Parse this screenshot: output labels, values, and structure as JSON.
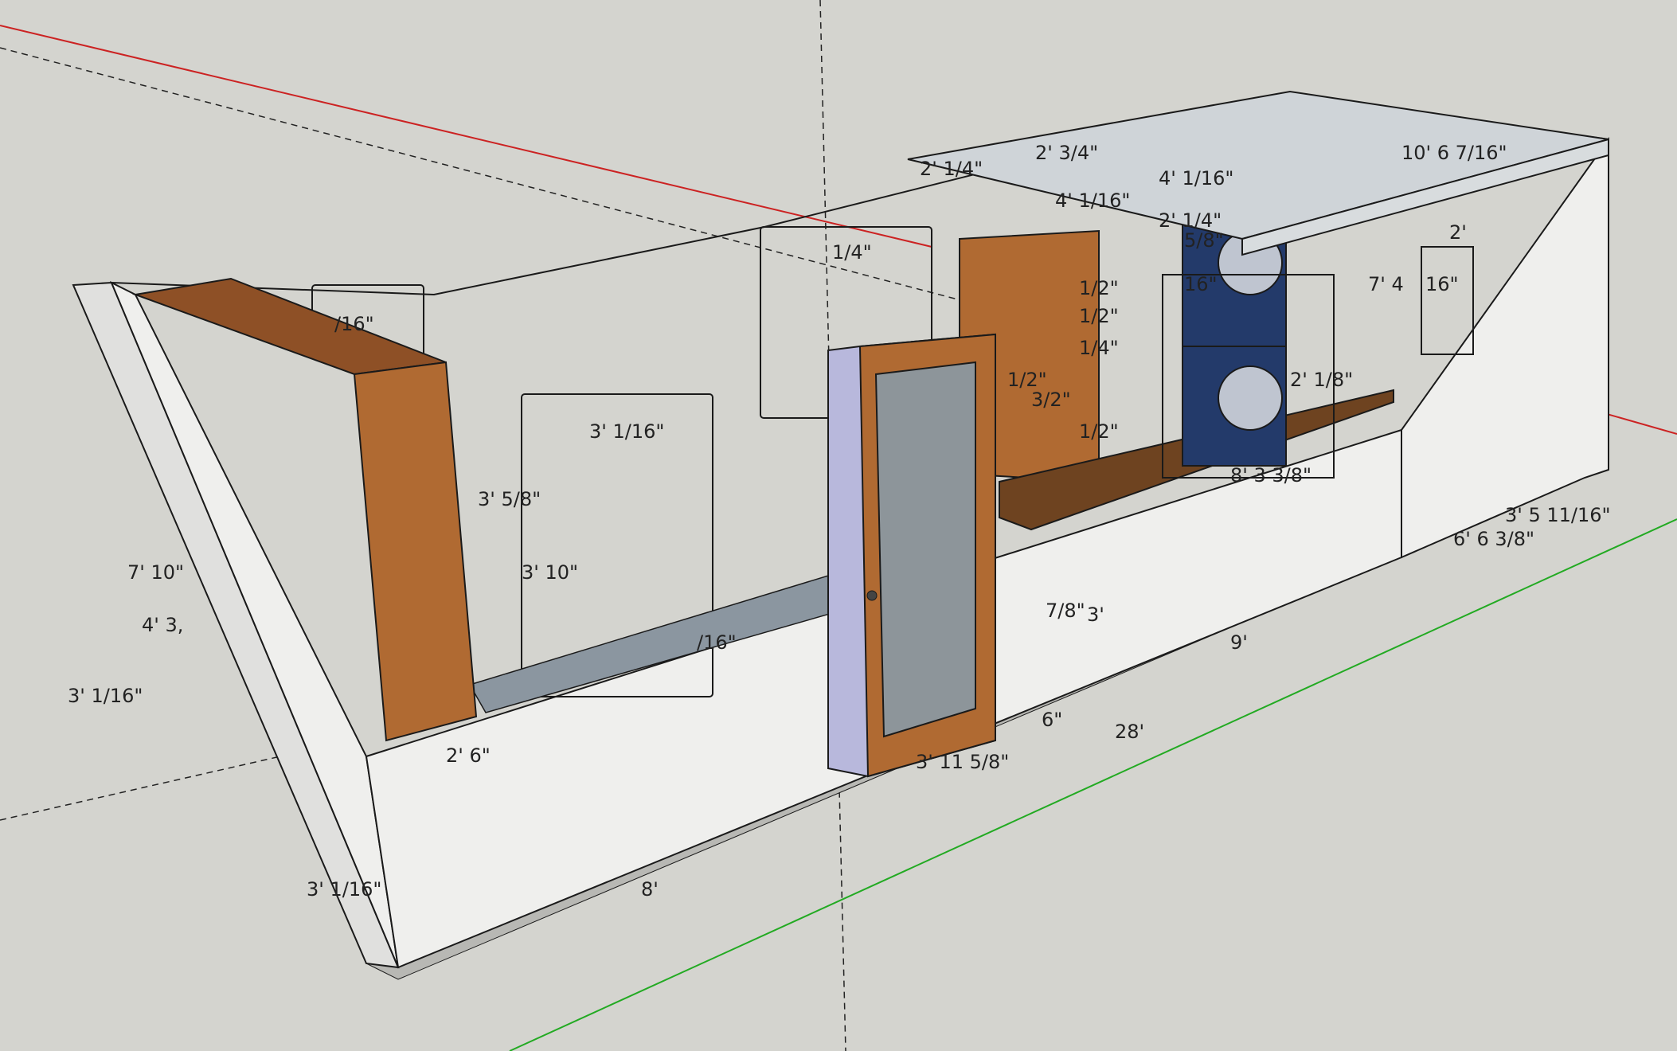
{
  "colors": {
    "background": "#d4d4cf",
    "wall": "#efefed",
    "wall_side": "#e4e4e2",
    "edge": "#1a1a1a",
    "floor": "#8b96a0",
    "wood": "#b06a32",
    "wood_dark": "#7a4420",
    "counter": "#6e4320",
    "door_frame": "#b8b8dc",
    "glass": "#8d959a",
    "appliance": "#233a6a",
    "axis_red": "#cc2222",
    "axis_green": "#22aa22"
  },
  "model": {
    "dimensions": [
      "7' 10\"",
      "4' 3,",
      "3' 1/16\"",
      "3' 1/16\"",
      "8'",
      "2' 6\"",
      "3' 10\"",
      "3' 1/16\"",
      "3' 5/8\"",
      "/16\"",
      "/16\"",
      "1/4\"",
      "3' 11 5/8\"",
      "28'",
      "6\"",
      "7/8\"",
      "3'",
      "9'",
      "8' 3 3/8\"",
      "6' 6 3/8\"",
      "3' 5 11/16\"",
      "10' 6 7/16\"",
      "2' 3/4\"",
      "2' 1/4\"",
      "4' 1/16\"",
      "4' 1/16\"",
      "2' 1/4\"",
      "5/8\"",
      "16\"",
      "2' 1/8\"",
      "7' 4",
      "16\"",
      "2'",
      "1/2\"",
      "1/2\"",
      "1/4\"",
      "1/2\"",
      "3/2\"",
      "1/2\""
    ]
  }
}
